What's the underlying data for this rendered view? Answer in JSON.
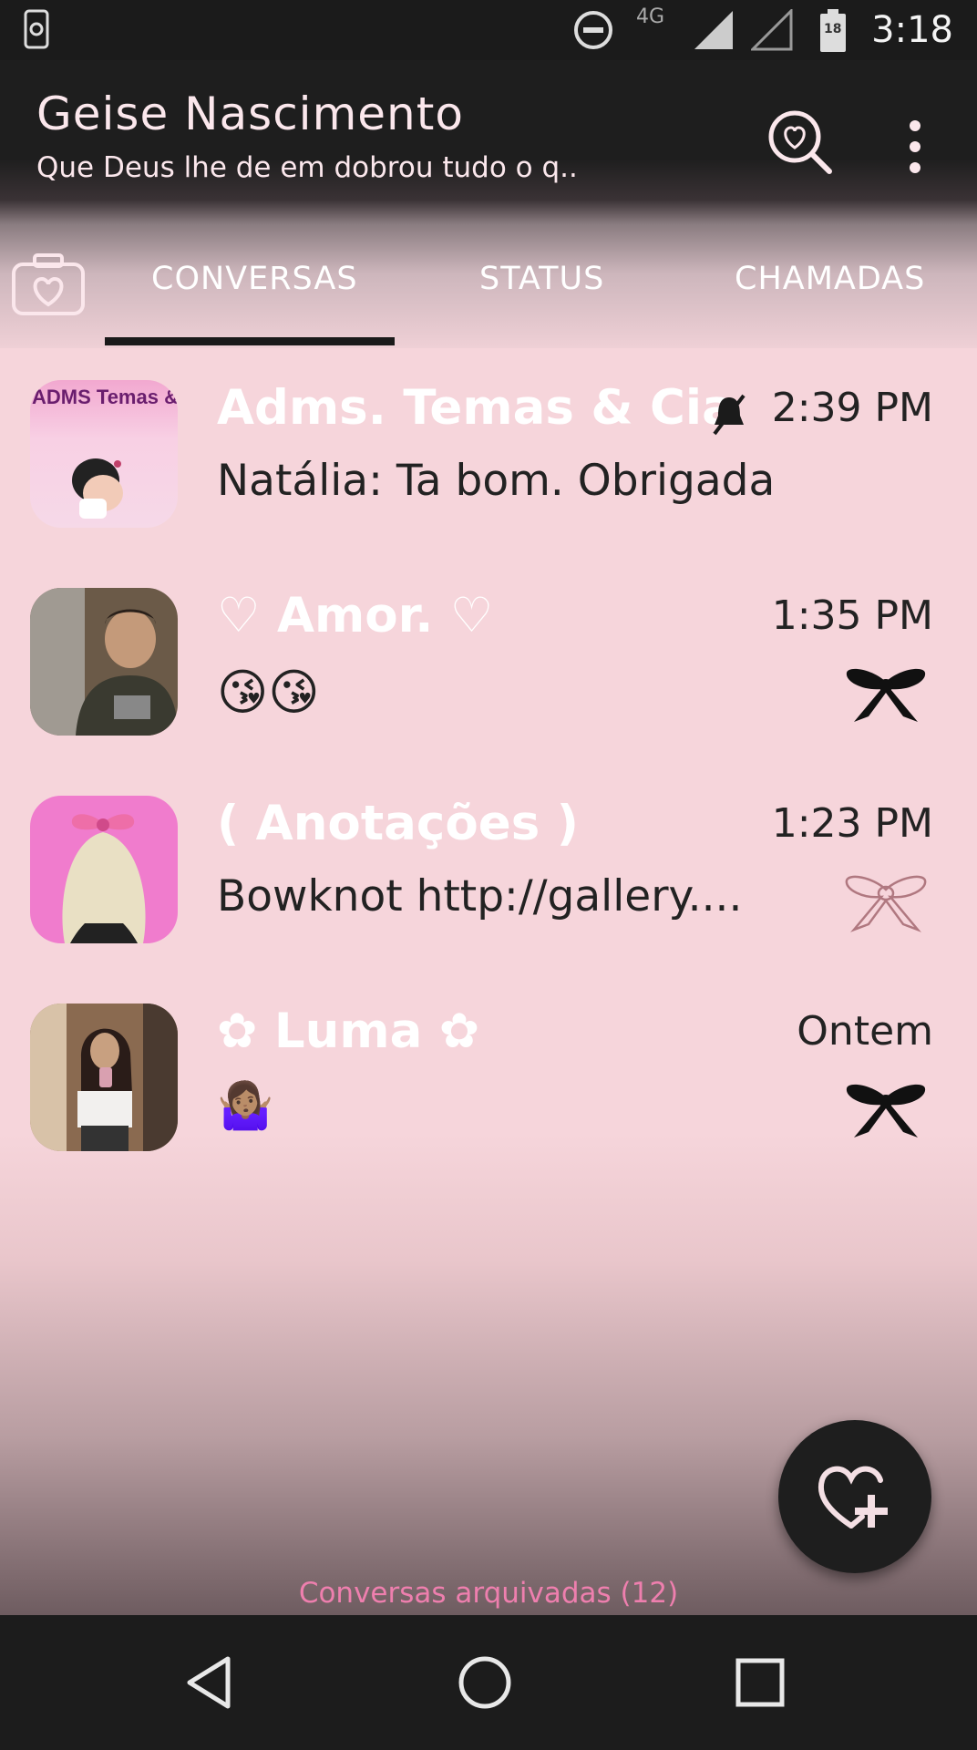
{
  "status_bar": {
    "network": "4G",
    "battery": "18",
    "time": "3:18"
  },
  "header": {
    "title": "Geise Nascimento",
    "subtitle": "Que Deus lhe de em dobrou tudo o q.."
  },
  "tabs": [
    {
      "label": "CONVERSAS",
      "selected": true
    },
    {
      "label": "STATUS",
      "selected": false
    },
    {
      "label": "CHAMADAS",
      "selected": false
    }
  ],
  "chats": [
    {
      "name": "Adms. Temas & Cia",
      "avatar_text": "ADMS Temas & Cia",
      "time": "2:39 PM",
      "last_message": "Natália: Ta bom. Obrigada",
      "muted": true
    },
    {
      "name": "♡ Amor. ♡",
      "time": "1:35 PM",
      "last_message": "😘😘",
      "bow_style": "black"
    },
    {
      "name": "( Anotações )",
      "time": "1:23 PM",
      "last_message": "Bowknot http://gallery....",
      "bow_style": "outline"
    },
    {
      "name": "✿ Luma ✿",
      "time": "Ontem",
      "last_message": "🤷🏽‍♀️",
      "bow_style": "black"
    }
  ],
  "archived": "Conversas arquivadas (12)",
  "colors": {
    "accent_pink": "#f6d5db",
    "header_dark": "#1e1e1e",
    "archived_text": "#ee7fae"
  }
}
